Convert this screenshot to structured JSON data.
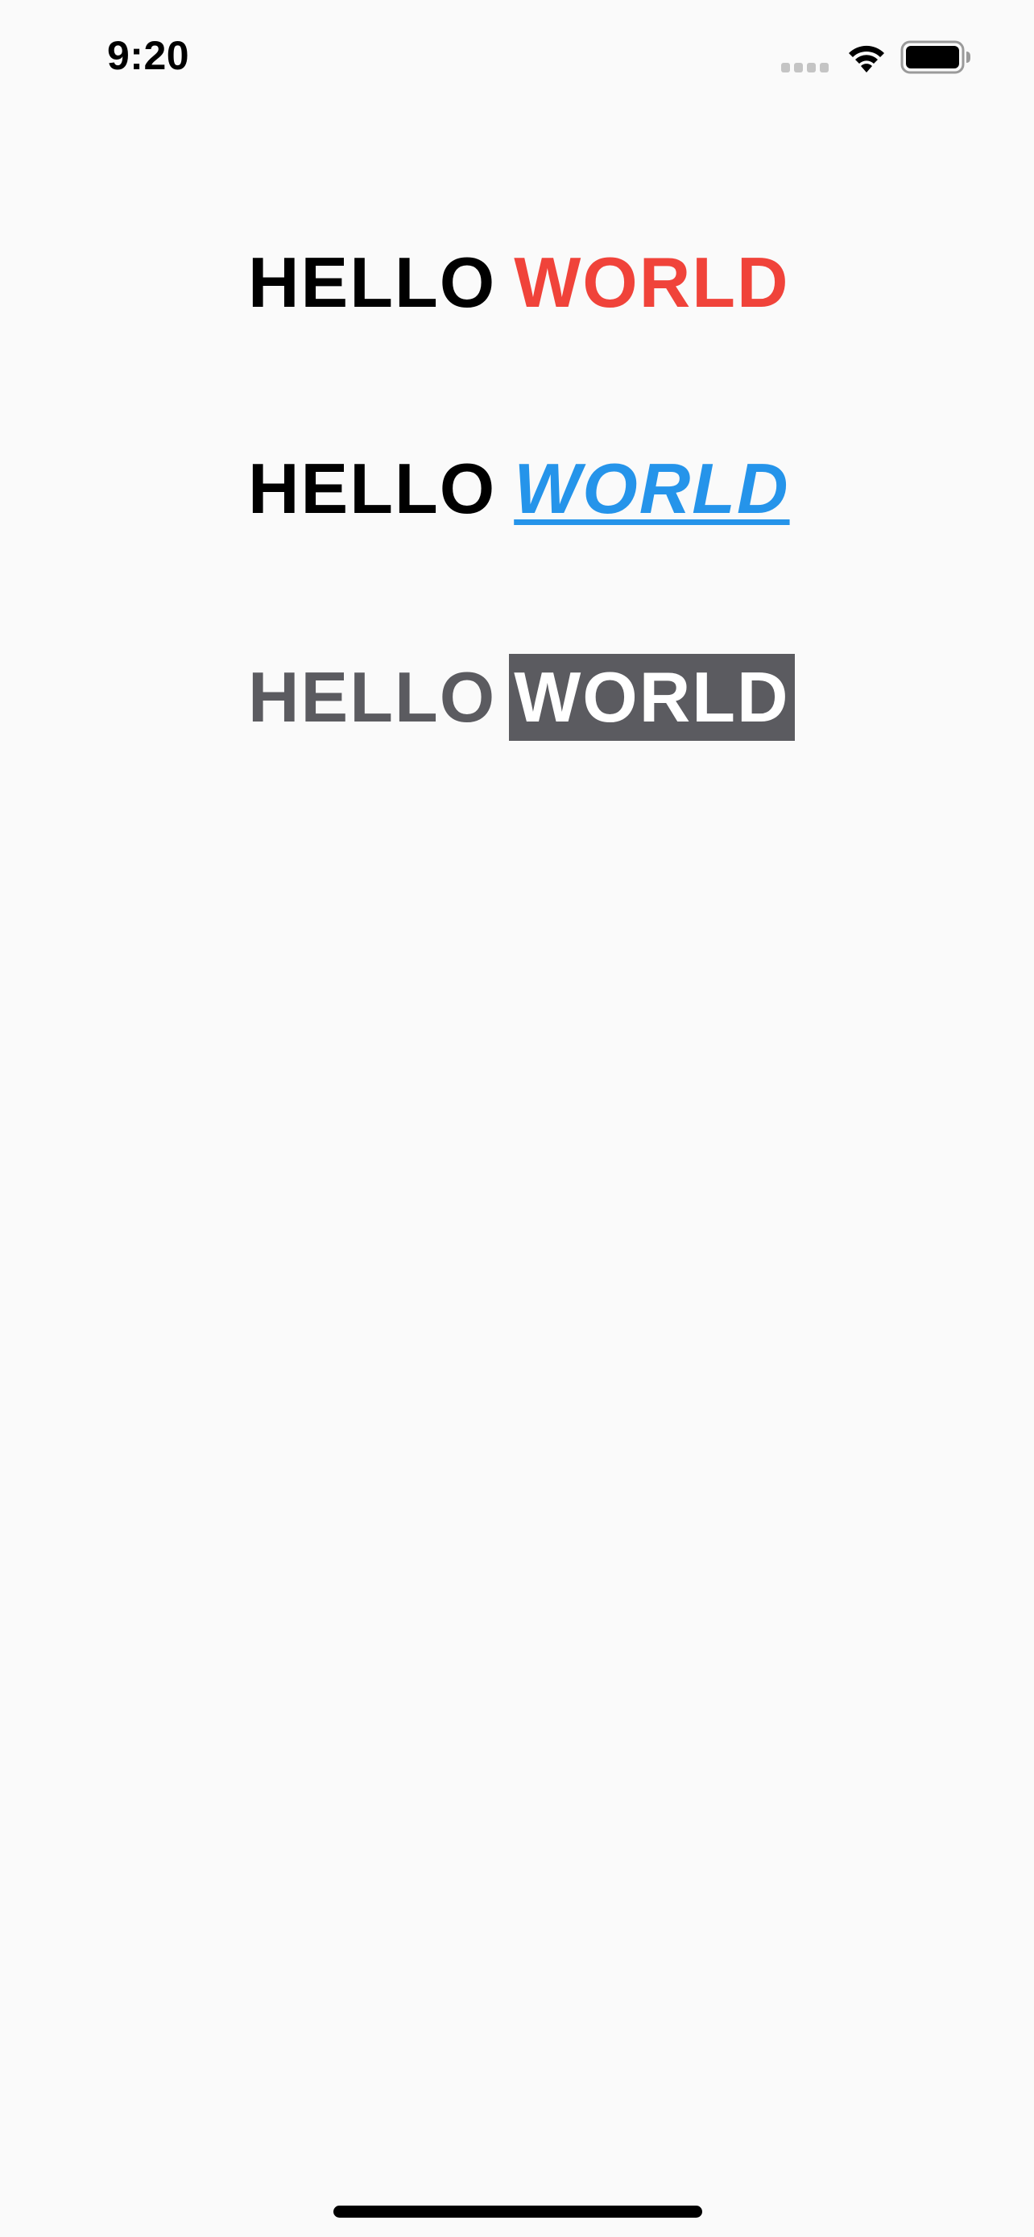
{
  "status_bar": {
    "time": "9:20"
  },
  "lines": [
    {
      "hello": "HELLO",
      "world": "WORLD",
      "world_style": "red"
    },
    {
      "hello": "HELLO",
      "world": "WORLD",
      "world_style": "blue-italic-underline"
    },
    {
      "hello": "HELLO",
      "world": "WORLD",
      "world_style": "highlight"
    }
  ],
  "colors": {
    "background": "#fafafa",
    "text_black": "#000000",
    "accent_red": "#f0433a",
    "accent_blue": "#2594ea",
    "gray": "#5b5b60",
    "white": "#ffffff"
  },
  "icons": {
    "signal": "cellular-signal-icon",
    "wifi": "wifi-icon",
    "battery": "battery-icon"
  }
}
